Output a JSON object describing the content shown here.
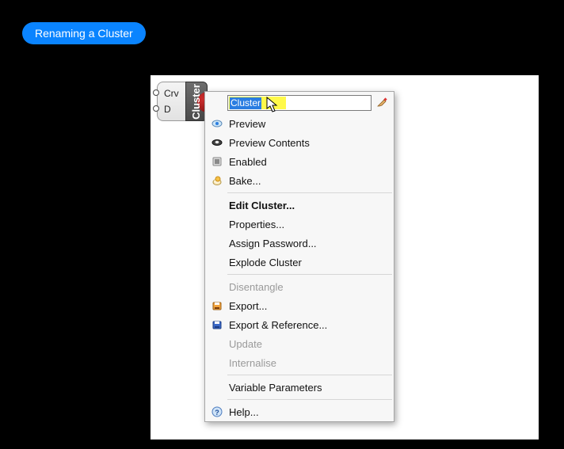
{
  "badge": "Renaming a Cluster",
  "component": {
    "inputs": [
      "Crv",
      "D"
    ],
    "label": "Cluster"
  },
  "rename": {
    "value": "Cluster"
  },
  "menu": {
    "preview": "Preview",
    "previewContents": "Preview Contents",
    "enabled": "Enabled",
    "bake": "Bake...",
    "editCluster": "Edit Cluster...",
    "properties": "Properties...",
    "assignPassword": "Assign Password...",
    "explodeCluster": "Explode Cluster",
    "disentangle": "Disentangle",
    "export": "Export...",
    "exportReference": "Export & Reference...",
    "update": "Update",
    "internalise": "Internalise",
    "variableParameters": "Variable Parameters",
    "help": "Help..."
  }
}
